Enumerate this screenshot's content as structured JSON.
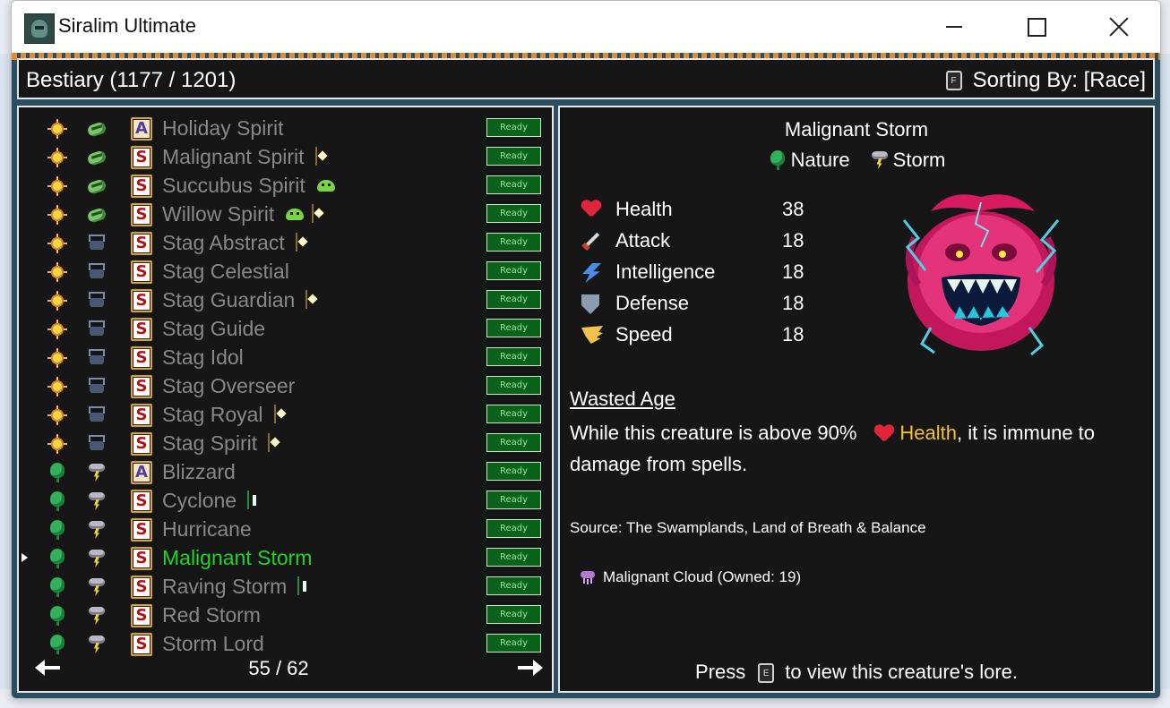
{
  "window": {
    "title": "Siralim Ultimate"
  },
  "header": {
    "title": "Bestiary (1177 / 1201)",
    "sort_key": "F",
    "sort_label": "Sorting By: [Race]"
  },
  "list": {
    "ready_label": "Ready",
    "rows": [
      {
        "name": "Holiday Spirit",
        "class_icon": "sun-icon",
        "race_icon": "spirit-race-icon",
        "card": "A",
        "badge": ""
      },
      {
        "name": "Malignant Spirit",
        "class_icon": "sun-icon",
        "race_icon": "spirit-race-icon",
        "card": "S",
        "badge": "gold-card-badge-icon"
      },
      {
        "name": "Succubus Spirit",
        "class_icon": "sun-icon",
        "race_icon": "spirit-race-icon",
        "card": "S",
        "badge": "green-blob-badge-icon"
      },
      {
        "name": "Willow Spirit",
        "class_icon": "sun-icon",
        "race_icon": "spirit-race-icon",
        "card": "S",
        "badge": "green-blob-and-gold-badge-icon"
      },
      {
        "name": "Stag Abstract",
        "class_icon": "sun-icon",
        "race_icon": "stag-race-icon",
        "card": "S",
        "badge": "gold-card-badge-icon"
      },
      {
        "name": "Stag Celestial",
        "class_icon": "sun-icon",
        "race_icon": "stag-race-icon",
        "card": "S",
        "badge": ""
      },
      {
        "name": "Stag Guardian",
        "class_icon": "sun-icon",
        "race_icon": "stag-race-icon",
        "card": "S",
        "badge": "gold-card-badge-icon"
      },
      {
        "name": "Stag Guide",
        "class_icon": "sun-icon",
        "race_icon": "stag-race-icon",
        "card": "S",
        "badge": ""
      },
      {
        "name": "Stag Idol",
        "class_icon": "sun-icon",
        "race_icon": "stag-race-icon",
        "card": "S",
        "badge": ""
      },
      {
        "name": "Stag Overseer",
        "class_icon": "sun-icon",
        "race_icon": "stag-race-icon",
        "card": "S",
        "badge": ""
      },
      {
        "name": "Stag Royal",
        "class_icon": "sun-icon",
        "race_icon": "stag-race-icon",
        "card": "S",
        "badge": "gold-card-badge-icon"
      },
      {
        "name": "Stag Spirit",
        "class_icon": "sun-icon",
        "race_icon": "stag-race-icon",
        "card": "S",
        "badge": "gold-card-badge-icon"
      },
      {
        "name": "Blizzard",
        "class_icon": "leaf-icon",
        "race_icon": "storm-race-icon",
        "card": "A",
        "badge": ""
      },
      {
        "name": "Cyclone",
        "class_icon": "leaf-icon",
        "race_icon": "storm-race-icon",
        "card": "S",
        "badge": "green-card-badge-icon"
      },
      {
        "name": "Hurricane",
        "class_icon": "leaf-icon",
        "race_icon": "storm-race-icon",
        "card": "S",
        "badge": ""
      },
      {
        "name": "Malignant Storm",
        "class_icon": "leaf-icon",
        "race_icon": "storm-race-icon",
        "card": "S",
        "badge": "",
        "selected": true
      },
      {
        "name": "Raving Storm",
        "class_icon": "leaf-icon",
        "race_icon": "storm-race-icon",
        "card": "S",
        "badge": "green-card-badge-icon"
      },
      {
        "name": "Red Storm",
        "class_icon": "leaf-icon",
        "race_icon": "storm-race-icon",
        "card": "S",
        "badge": ""
      },
      {
        "name": "Storm Lord",
        "class_icon": "leaf-icon",
        "race_icon": "storm-race-icon",
        "card": "S",
        "badge": ""
      }
    ],
    "page": "55 / 62"
  },
  "detail": {
    "name": "Malignant Storm",
    "class": {
      "label": "Nature",
      "icon": "leaf-icon"
    },
    "race": {
      "label": "Storm",
      "icon": "storm-race-icon"
    },
    "stats": [
      {
        "label": "Health",
        "value": "38",
        "icon": "heart-icon"
      },
      {
        "label": "Attack",
        "value": "18",
        "icon": "sword-icon"
      },
      {
        "label": "Intelligence",
        "value": "18",
        "icon": "lightning-icon"
      },
      {
        "label": "Defense",
        "value": "18",
        "icon": "shield-icon"
      },
      {
        "label": "Speed",
        "value": "18",
        "icon": "wing-icon"
      }
    ],
    "ability": {
      "name": "Wasted Age",
      "desc_before": "While this creature is above 90%",
      "desc_highlight": "Health",
      "desc_after": ", it is immune to damage from spells."
    },
    "source": "Source: The Swamplands, Land of Breath & Balance",
    "material": "Malignant Cloud (Owned: 19)",
    "lore": {
      "before": "Press",
      "key": "E",
      "after": "to view this creature's lore."
    }
  },
  "colors": {
    "selected": "#21d32a",
    "unselected": "#888888",
    "highlight": "#f2c12e",
    "ready_bg": "#08621a",
    "panel_bg": "#161616",
    "border": "#e8e8e8"
  }
}
